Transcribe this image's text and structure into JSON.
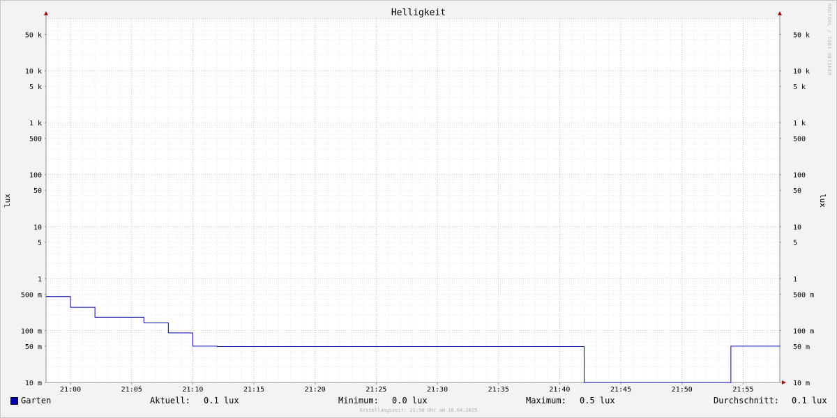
{
  "chart_data": {
    "type": "line",
    "title": "Helligkeit",
    "ylabel": "lux",
    "y_scale": "log",
    "ylim": [
      0.01,
      100000
    ],
    "xlim": [
      "20:58",
      "21:58"
    ],
    "grid": true,
    "y_tick_labels": [
      {
        "value": 50000,
        "label": "50 k"
      },
      {
        "value": 10000,
        "label": "10 k"
      },
      {
        "value": 5000,
        "label": "5 k"
      },
      {
        "value": 1000,
        "label": "1 k"
      },
      {
        "value": 500,
        "label": "500"
      },
      {
        "value": 100,
        "label": "100"
      },
      {
        "value": 50,
        "label": "50"
      },
      {
        "value": 10,
        "label": "10"
      },
      {
        "value": 5,
        "label": "5"
      },
      {
        "value": 1,
        "label": "1"
      },
      {
        "value": 0.5,
        "label": "500 m"
      },
      {
        "value": 0.1,
        "label": "100 m"
      },
      {
        "value": 0.05,
        "label": "50 m"
      },
      {
        "value": 0.01,
        "label": "10 m"
      }
    ],
    "x_tick_labels": [
      "21:00",
      "21:05",
      "21:10",
      "21:15",
      "21:20",
      "21:25",
      "21:30",
      "21:35",
      "21:40",
      "21:45",
      "21:50",
      "21:55"
    ],
    "series": [
      {
        "name": "Garten",
        "color": "#0000aa",
        "points": [
          {
            "x": "20:58",
            "y": 0.45
          },
          {
            "x": "21:00",
            "y": 0.28
          },
          {
            "x": "21:02",
            "y": 0.18
          },
          {
            "x": "21:06",
            "y": 0.14
          },
          {
            "x": "21:08",
            "y": 0.09
          },
          {
            "x": "21:10",
            "y": 0.05
          },
          {
            "x": "21:12",
            "y": 0.049
          },
          {
            "x": "21:42",
            "y": 0.01
          },
          {
            "x": "21:54",
            "y": 0.05
          },
          {
            "x": "21:58",
            "y": 0.05
          }
        ]
      }
    ]
  },
  "legend": {
    "series_name": "Garten",
    "current_label": "Aktuell:",
    "current_value": "0.1 lux",
    "min_label": "Minimum:",
    "min_value": "0.0 lux",
    "max_label": "Maximum:",
    "max_value": "0.5 lux",
    "avg_label": "Durchschnitt:",
    "avg_value": "0.1 lux"
  },
  "watermark": "RRDTOOL / TOBI OETIKER",
  "footer": "Erstellungszeit: 21:58 Uhr am 18.04.2025"
}
